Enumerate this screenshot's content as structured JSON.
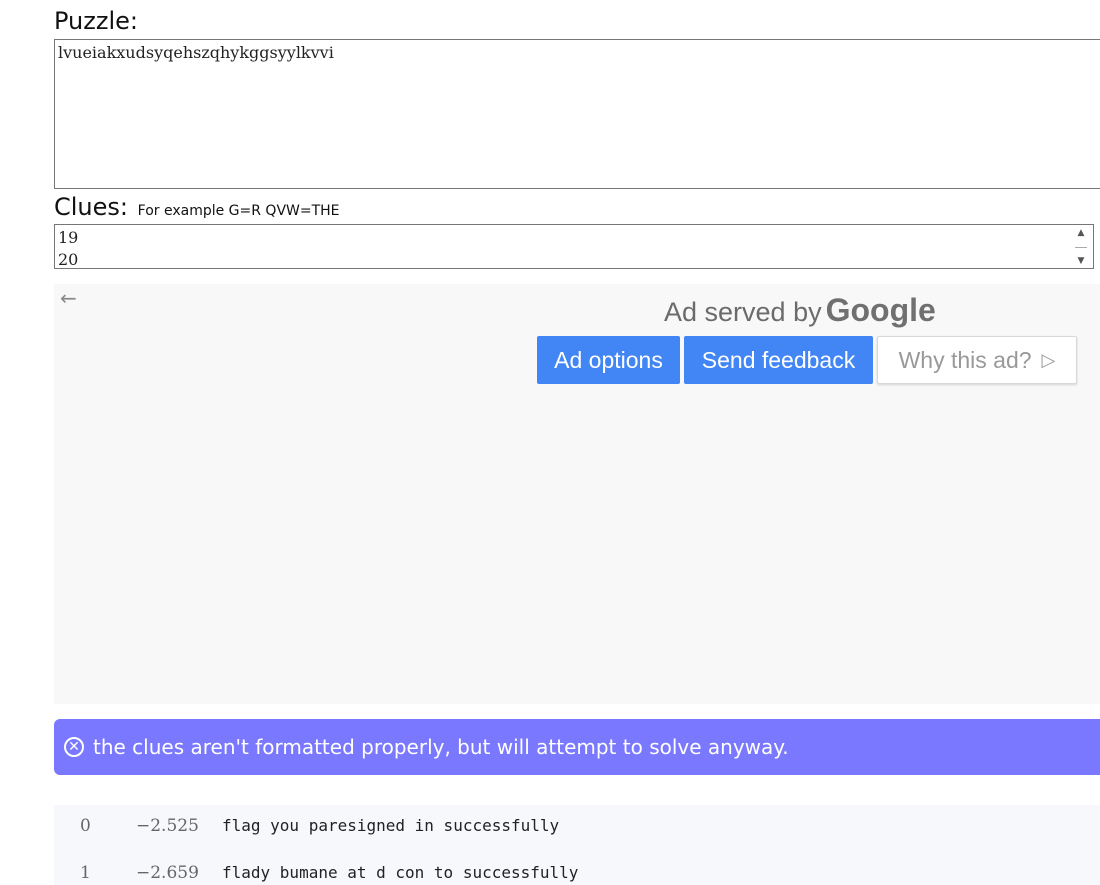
{
  "puzzle": {
    "label": "Puzzle:",
    "value": "lvueiakxudsyqehszqhykggsyylkvvi"
  },
  "clues": {
    "label": "Clues:",
    "hint": "For example G=R QVW=THE",
    "value": "19\n20"
  },
  "ad": {
    "served_by": "Ad served by",
    "brand": "Google",
    "ad_options": "Ad options",
    "send_feedback": "Send feedback",
    "why_this_ad": "Why this ad?",
    "background_color": "#f8f8f8",
    "button_color": "#4285f4"
  },
  "alert": {
    "icon": "circle-x-icon",
    "message": "the clues aren't formatted properly, but will attempt to solve anyway.",
    "color": "#7a78ff"
  },
  "results": [
    {
      "index": "0",
      "score": "−2.525",
      "text": "flag you paresigned in successfully"
    },
    {
      "index": "1",
      "score": "−2.659",
      "text": "flady bumane at d con to successfully"
    }
  ]
}
